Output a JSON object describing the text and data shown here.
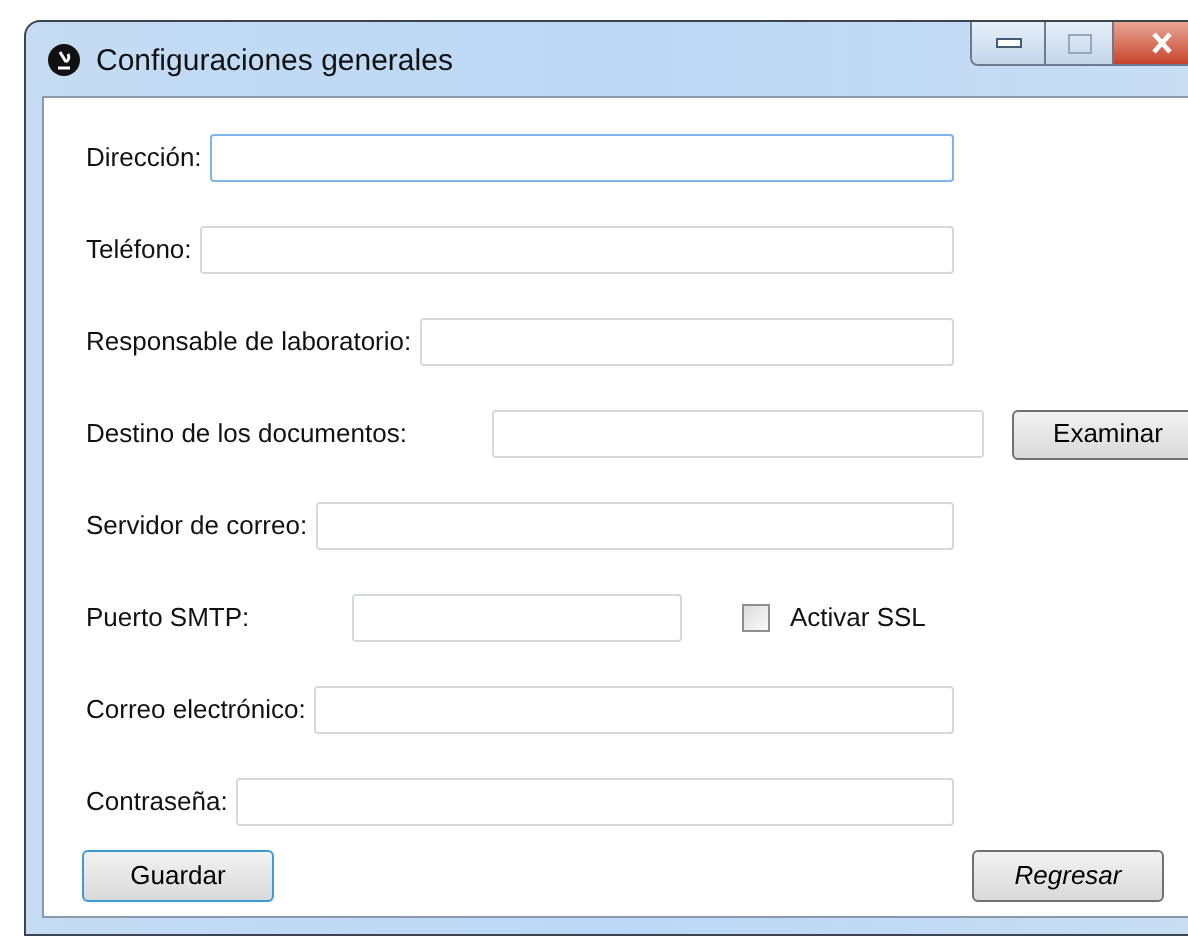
{
  "window": {
    "title": "Configuraciones generales"
  },
  "fields": [
    {
      "kind": "text",
      "label": "Dirección:",
      "focused": true
    },
    {
      "kind": "text",
      "label": "Teléfono:",
      "focused": false
    },
    {
      "kind": "text",
      "label": "Responsable de laboratorio:",
      "focused": false
    },
    {
      "kind": "browse",
      "label": "Destino de los documentos:",
      "focused": false,
      "button": "Examinar"
    },
    {
      "kind": "text",
      "label": "Servidor de correo:",
      "focused": false
    },
    {
      "kind": "port",
      "label": "Puerto SMTP:",
      "focused": false,
      "checkbox": {
        "label": "Activar SSL",
        "checked": false
      }
    },
    {
      "kind": "text",
      "label": "Correo electrónico:",
      "focused": false
    },
    {
      "kind": "text",
      "label": "Contraseña:",
      "focused": false
    }
  ],
  "buttons": {
    "save": "Guardar",
    "back": "Regresar"
  }
}
